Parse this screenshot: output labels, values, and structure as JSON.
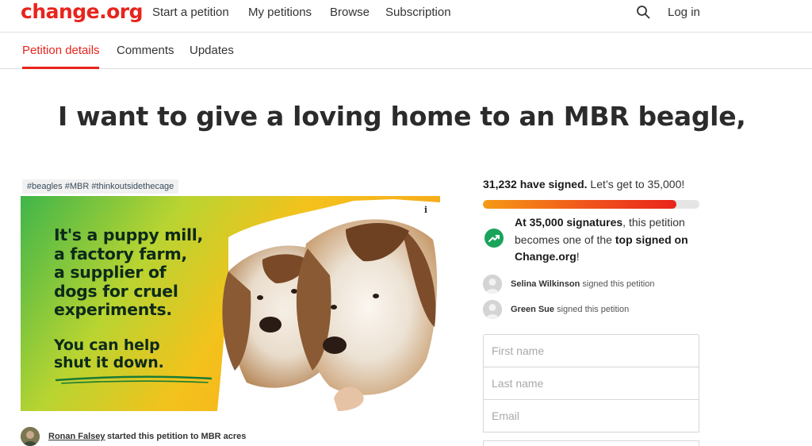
{
  "nav": {
    "logo": "change.org",
    "links": [
      "Start a petition",
      "My petitions",
      "Browse",
      "Subscription"
    ],
    "login": "Log in"
  },
  "tabs": [
    "Petition details",
    "Comments",
    "Updates"
  ],
  "petition": {
    "title": "I want to give a loving home to an MBR beagle,",
    "tags": "#beagles #MBR #thinkoutsidethecage",
    "image_text": [
      "It's a puppy mill,",
      "a factory farm,",
      "a supplier of",
      "dogs for cruel",
      "experiments."
    ],
    "image_cta": [
      "You can help",
      "shut it down."
    ],
    "starter_name": "Ronan Falsey",
    "starter_rest": "started this petition to MBR acres"
  },
  "signatures": {
    "count": "31,232 have signed.",
    "goal_text": "Let’s get to 35,000!",
    "progress_fraction": 0.892,
    "milestone_bold": "At 35,000 signatures",
    "milestone_mid": ", this petition becomes one of the ",
    "milestone_bold2": "top signed on Change.org",
    "milestone_end": "!",
    "recent": [
      {
        "name": "Selina Wilkinson",
        "action": "signed this petition"
      },
      {
        "name": "Green Sue",
        "action": "signed this petition"
      }
    ]
  },
  "form": {
    "first_name_placeholder": "First name",
    "last_name_placeholder": "Last name",
    "email_placeholder": "Email"
  },
  "colors": {
    "brand": "#e8241c",
    "milestone_green": "#1aa35a"
  },
  "icons": {
    "search": "search-icon",
    "milestone": "trending-up-icon",
    "info": "info-icon"
  }
}
